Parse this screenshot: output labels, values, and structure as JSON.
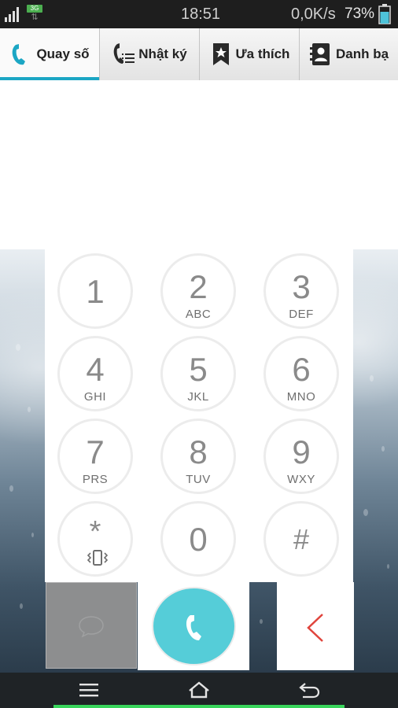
{
  "status_bar": {
    "network_badge": "3G",
    "network_arrows": "⇅",
    "time": "18:51",
    "speed": "0,0K/s",
    "battery_percent": "73%",
    "battery_level": 0.73
  },
  "tabs": [
    {
      "label": "Quay số",
      "icon": "phone-icon",
      "active": true
    },
    {
      "label": "Nhật ký",
      "icon": "call-log-icon",
      "active": false
    },
    {
      "label": "Ưa thích",
      "icon": "bookmark-star-icon",
      "active": false
    },
    {
      "label": "Danh bạ",
      "icon": "contacts-icon",
      "active": false
    }
  ],
  "dialpad": {
    "keys": [
      {
        "digit": "1",
        "letters": ""
      },
      {
        "digit": "2",
        "letters": "ABC"
      },
      {
        "digit": "3",
        "letters": "DEF"
      },
      {
        "digit": "4",
        "letters": "GHI"
      },
      {
        "digit": "5",
        "letters": "JKL"
      },
      {
        "digit": "6",
        "letters": "MNO"
      },
      {
        "digit": "7",
        "letters": "PRS"
      },
      {
        "digit": "8",
        "letters": "TUV"
      },
      {
        "digit": "9",
        "letters": "WXY"
      },
      {
        "digit": "*",
        "letters": ""
      },
      {
        "digit": "0",
        "letters": ""
      },
      {
        "digit": "#",
        "letters": ""
      }
    ]
  },
  "actions": {
    "message_icon": "speech-bubble-icon",
    "call_icon": "phone-handset-icon",
    "delete_icon": "chevron-left-icon",
    "call_color": "#55cdd8",
    "delete_color": "#e0443c"
  },
  "navbar": {
    "menu_icon": "menu-icon",
    "home_icon": "home-icon",
    "back_icon": "back-icon",
    "accent_color": "#39d55c"
  }
}
